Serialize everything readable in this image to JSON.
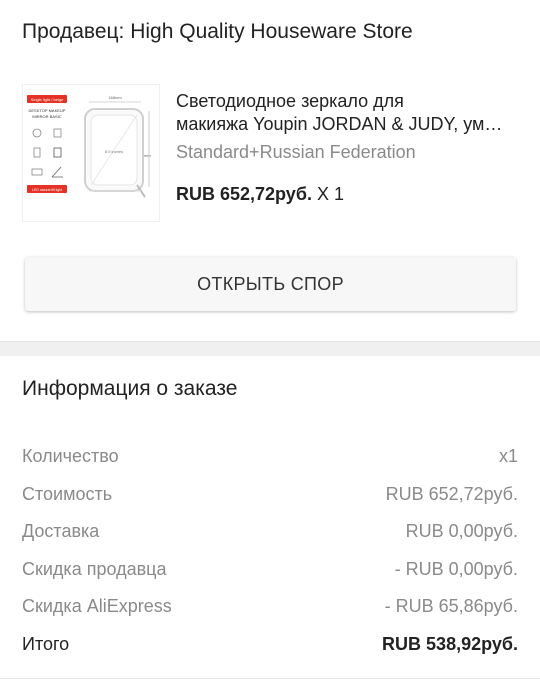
{
  "seller": {
    "label": "Продавец: High Quality Houseware Store"
  },
  "product": {
    "image_badge": "Single light / beige",
    "image_heading_1": "DESKTOP MAKEUP",
    "image_heading_2": "MIRROR BASIC",
    "image_dim_top": "168mm",
    "image_dim_side": "230mm",
    "image_size_label": "8.5 inches",
    "image_footer": "LED natural fill light",
    "title_line1": "Светодиодное зеркало для",
    "title_line2": "макияжа Youpin JORDAN & JUDY, ум…",
    "variant": "Standard+Russian Federation",
    "price": "RUB 652,72руб.",
    "quantity": " X 1"
  },
  "dispute_button": {
    "label": "ОТКРЫТЬ СПОР"
  },
  "order_info": {
    "title": "Информация о заказе",
    "rows": [
      {
        "label": "Количество",
        "value": "x1"
      },
      {
        "label": "Стоимость",
        "value": "RUB 652,72руб."
      },
      {
        "label": "Доставка",
        "value": "RUB 0,00руб."
      },
      {
        "label": "Скидка продавца",
        "value": "- RUB 0,00руб."
      },
      {
        "label": "Скидка AliExpress",
        "value": "- RUB 65,86руб."
      },
      {
        "label": "Итого",
        "value": "RUB 538,92руб."
      }
    ]
  },
  "colors": {
    "accent_red": "#e43225",
    "muted_text": "#8a8a8a"
  }
}
